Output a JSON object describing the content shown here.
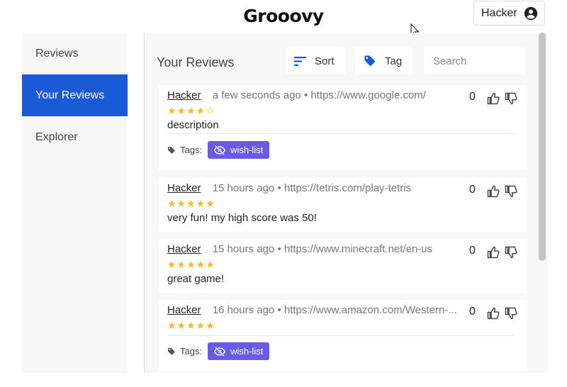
{
  "app": {
    "title": "Grooovy"
  },
  "user": {
    "name": "Hacker"
  },
  "sidebar": {
    "items": [
      {
        "label": "Reviews",
        "active": false
      },
      {
        "label": "Your Reviews",
        "active": true
      },
      {
        "label": "Explorer",
        "active": false
      }
    ]
  },
  "main": {
    "title": "Your Reviews",
    "sort_label": "Sort",
    "tag_label": "Tag",
    "search_placeholder": "Search"
  },
  "reviews": [
    {
      "author": "Hacker",
      "time": "a few seconds ago",
      "url": "https://www.google.com/",
      "rating": 4,
      "stars": "★★★★☆",
      "description": "description",
      "score": "0",
      "tags_label": "Tags:",
      "tags": [
        "wish-list"
      ]
    },
    {
      "author": "Hacker",
      "time": "15 hours ago",
      "url": "https://tetris.com/play-tetris",
      "rating": 5,
      "stars": "★★★★★",
      "description": "very fun! my high score was 50!",
      "score": "0",
      "tags_label": "",
      "tags": []
    },
    {
      "author": "Hacker",
      "time": "15 hours ago",
      "url": "https://www.minecraft.net/en-us",
      "rating": 5,
      "stars": "★★★★★",
      "description": "great game!",
      "score": "0",
      "tags_label": "",
      "tags": []
    },
    {
      "author": "Hacker",
      "time": "16 hours ago",
      "url": "https://www.amazon.com/Western-...",
      "rating": 5,
      "stars": "★★★★★",
      "description": "",
      "score": "0",
      "tags_label": "Tags:",
      "tags": [
        "wish-list"
      ]
    }
  ],
  "separator": "•",
  "colors": {
    "accent": "#1a5ad6",
    "tag": "#6a5ae6",
    "star": "#f5b82e"
  }
}
